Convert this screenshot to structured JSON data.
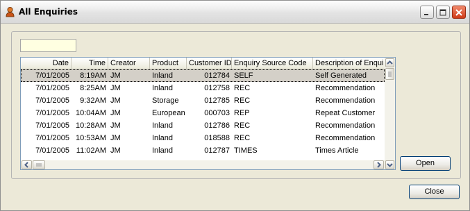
{
  "window": {
    "title": "All Enquiries",
    "icon": "app-person-icon",
    "buttons": [
      "minimize-icon",
      "maximize-icon",
      "close-icon"
    ]
  },
  "filter": {
    "value": ""
  },
  "grid": {
    "columns": [
      "Date",
      "Time",
      "Creator",
      "Product",
      "Customer ID",
      "Enquiry Source Code",
      "Description of Enqui"
    ],
    "rows": [
      [
        "7/01/2005",
        "8:19AM",
        "JM",
        "Inland",
        "012784",
        "SELF",
        "Self Generated"
      ],
      [
        "7/01/2005",
        "8:25AM",
        "JM",
        "Inland",
        "012758",
        "REC",
        "Recommendation"
      ],
      [
        "7/01/2005",
        "9:32AM",
        "JM",
        "Storage",
        "012785",
        "REC",
        "Recommendation"
      ],
      [
        "7/01/2005",
        "10:04AM",
        "JM",
        "European",
        "000703",
        "REP",
        "Repeat Customer"
      ],
      [
        "7/01/2005",
        "10:28AM",
        "JM",
        "Inland",
        "012786",
        "REC",
        "Recommendation"
      ],
      [
        "7/01/2005",
        "10:53AM",
        "JM",
        "Inland",
        "018588",
        "REC",
        "Recommendation"
      ],
      [
        "7/01/2005",
        "11:02AM",
        "JM",
        "Inland",
        "012787",
        "TIMES",
        "Times Article"
      ]
    ],
    "selected_row": 0
  },
  "buttons": {
    "open": "Open",
    "close": "Close"
  }
}
